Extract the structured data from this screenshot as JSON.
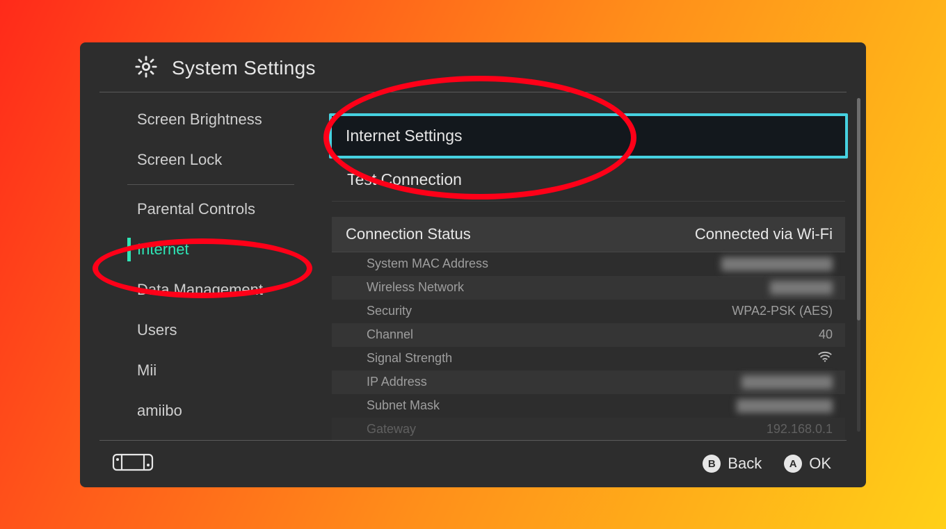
{
  "header": {
    "title": "System Settings"
  },
  "sidebar": {
    "items": [
      {
        "label": "Screen Brightness"
      },
      {
        "label": "Screen Lock"
      },
      {
        "label": "Parental Controls"
      },
      {
        "label": "Internet"
      },
      {
        "label": "Data Management"
      },
      {
        "label": "Users"
      },
      {
        "label": "Mii"
      },
      {
        "label": "amiibo"
      }
    ]
  },
  "main": {
    "options": [
      {
        "label": "Internet Settings"
      },
      {
        "label": "Test Connection"
      }
    ],
    "status": {
      "title": "Connection Status",
      "value": "Connected via Wi-Fi"
    },
    "details": [
      {
        "label": "System MAC Address",
        "value": "",
        "redacted": true,
        "alt": true
      },
      {
        "label": "Wireless Network",
        "value": "",
        "redacted": true,
        "alt": false
      },
      {
        "label": "Security",
        "value": "WPA2-PSK (AES)",
        "redacted": false,
        "alt": true
      },
      {
        "label": "Channel",
        "value": "40",
        "redacted": false,
        "alt": false
      },
      {
        "label": "Signal Strength",
        "value": "wifi-icon",
        "redacted": false,
        "alt": true
      },
      {
        "label": "IP Address",
        "value": "",
        "redacted": true,
        "alt": false
      },
      {
        "label": "Subnet Mask",
        "value": "",
        "redacted": true,
        "alt": true
      },
      {
        "label": "Gateway",
        "value": "192.168.0.1",
        "redacted": false,
        "alt": false
      }
    ]
  },
  "footer": {
    "back_label": "Back",
    "ok_label": "OK",
    "back_glyph": "B",
    "ok_glyph": "A"
  }
}
